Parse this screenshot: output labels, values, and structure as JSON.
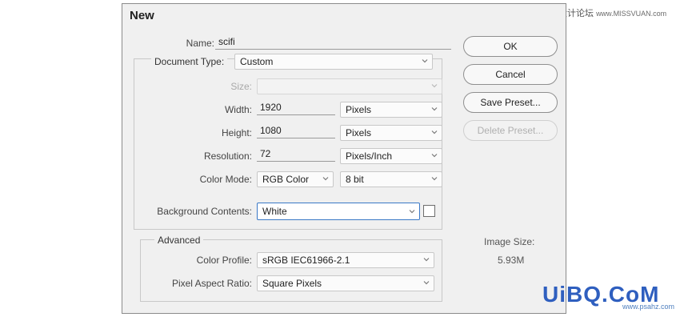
{
  "dialog": {
    "title": "New",
    "name_label": "Name:",
    "name_value": "scifi",
    "document_type_label": "Document Type:",
    "document_type_value": "Custom",
    "size_label": "Size:",
    "size_value": "",
    "width_label": "Width:",
    "width_value": "1920",
    "width_unit": "Pixels",
    "height_label": "Height:",
    "height_value": "1080",
    "height_unit": "Pixels",
    "resolution_label": "Resolution:",
    "resolution_value": "72",
    "resolution_unit": "Pixels/Inch",
    "color_mode_label": "Color Mode:",
    "color_mode_value": "RGB Color",
    "bit_depth_value": "8 bit",
    "background_label": "Background Contents:",
    "background_value": "White",
    "background_swatch_color": "#ffffff",
    "advanced": {
      "title": "Advanced",
      "color_profile_label": "Color Profile:",
      "color_profile_value": "sRGB IEC61966-2.1",
      "pixel_aspect_label": "Pixel Aspect Ratio:",
      "pixel_aspect_value": "Square Pixels"
    },
    "buttons": {
      "ok": "OK",
      "cancel": "Cancel",
      "save_preset": "Save Preset...",
      "delete_preset": "Delete Preset..."
    },
    "image_size_label": "Image Size:",
    "image_size_value": "5.93M"
  },
  "watermark": {
    "top_text": "思缘设计论坛",
    "top_url": "www.MISSVUAN.com",
    "brand": "UiBQ.CoM",
    "brand_url": "www.psahz.com"
  },
  "colors": {
    "accent_focus": "#3a78c6",
    "brand_blue": "#2f5fbf"
  }
}
